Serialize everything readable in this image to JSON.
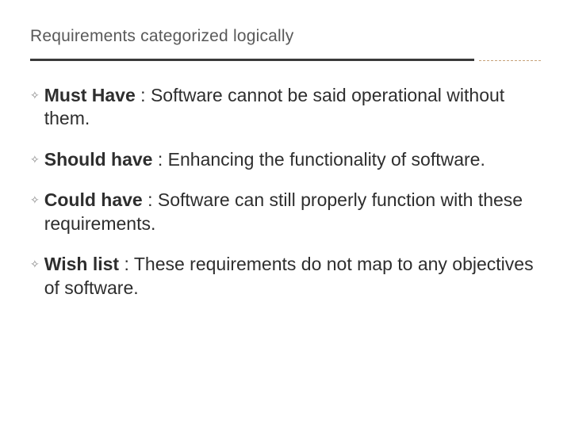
{
  "title": "Requirements categorized logically",
  "bullet_glyph": "✧",
  "items": [
    {
      "label": "Must Have",
      "sep": " : ",
      "desc": "Software cannot be said operational without them."
    },
    {
      "label": "Should have",
      "sep": " : ",
      "desc": "Enhancing the functionality of software."
    },
    {
      "label": "Could have",
      "sep": " : ",
      "desc": "Software can still properly function with these requirements."
    },
    {
      "label": "Wish list",
      "sep": " : ",
      "desc": "These requirements do not map to any objectives of software."
    }
  ]
}
